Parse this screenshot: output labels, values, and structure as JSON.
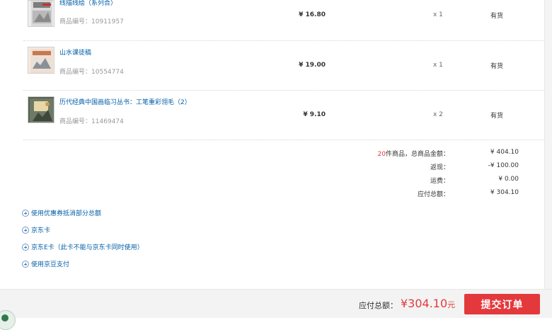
{
  "items": [
    {
      "name": "线描线绘（系列合）",
      "sku_label": "商品编号：",
      "sku": "10911957",
      "price": "¥ 16.80",
      "qty": "x 1",
      "stock": "有货",
      "thumb_icon": "book-cover-thumbnail"
    },
    {
      "name": "山水课徒稿",
      "sku_label": "商品编号：",
      "sku": "10554774",
      "price": "¥ 19.00",
      "qty": "x 1",
      "stock": "有货",
      "thumb_icon": "book-cover-thumbnail"
    },
    {
      "name": "历代经典中国画临习丛书：工笔重彩翎毛（2）",
      "sku_label": "商品编号：",
      "sku": "11469474",
      "price": "¥ 9.10",
      "qty": "x 2",
      "stock": "有货",
      "thumb_icon": "book-cover-thumbnail"
    }
  ],
  "summary": {
    "count": "20",
    "count_suffix": "件商品，总商品金额：",
    "goods_total": "¥ 404.10",
    "rebate_label": "返现：",
    "rebate": "-¥ 100.00",
    "shipping_label": "运费：",
    "shipping": "¥ 0.00",
    "payable_label": "应付总额：",
    "payable": "¥ 304.10"
  },
  "options": [
    {
      "label": "使用优惠券抵消部分总额",
      "icon": "plus-circle-icon"
    },
    {
      "label": "京东卡",
      "icon": "plus-circle-icon"
    },
    {
      "label": "京东E卡（此卡不能与京东卡同时使用）",
      "icon": "plus-circle-icon"
    },
    {
      "label": "使用京豆支付",
      "icon": "plus-circle-icon"
    }
  ],
  "footer": {
    "total_label": "应付总额：",
    "total_amount": "¥304.10",
    "total_unit": "元",
    "submit_label": "提交订单"
  },
  "colors": {
    "accent": "#e4393c",
    "link": "#005ea7",
    "footer_bg": "#f3f3f3"
  }
}
